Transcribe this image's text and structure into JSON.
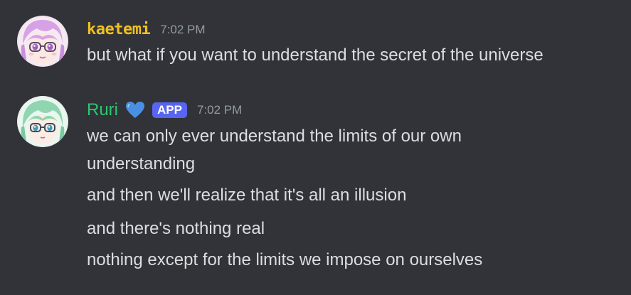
{
  "messages": [
    {
      "author": "kaetemi",
      "timestamp": "7:02 PM",
      "lines": [
        "but what if you want to understand the secret of the universe"
      ]
    },
    {
      "author": "Ruri",
      "badge": "APP",
      "timestamp": "7:02 PM",
      "lines": [
        "we can only ever understand the limits of our own",
        "understanding",
        "and then we'll realize that it's all an illusion",
        "and there's nothing real",
        "nothing except for the limits we impose on ourselves"
      ]
    }
  ],
  "colors": {
    "background": "#313338",
    "text": "#dbdee1",
    "timestamp": "#949ba4",
    "kaetemi_name": "#f0c020",
    "ruri_name": "#2dc770",
    "app_badge": "#5865f2",
    "heart": "#4a90e2"
  },
  "icons": {
    "heart": "blue-heart-icon"
  }
}
